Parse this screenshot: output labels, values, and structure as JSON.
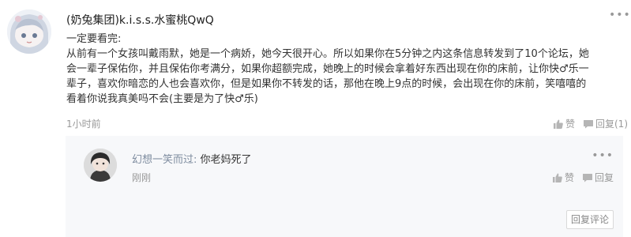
{
  "comment": {
    "username": "(奶兔集团)k.i.s.s.水蜜桃QwQ",
    "more_icon": "more-dots-icon",
    "lines": [
      "一定要看完:",
      "从前有一个女孩叫戴雨默，她是一个病娇，她今天很开心。所以如果你在5分钟之内这条信息转发到了10个论坛，她",
      "会一辈子保佑你，并且保佑你考满分，如果你超额完成，她晚上的时候会拿着好东西出现在你的床前，让你快♂乐一",
      "辈子，喜欢你暗恋的人也会喜欢你，但是如果你不转发的话，那他在晚上9点的时候，会出现在你的床前，笑嘻嘻的",
      "看着你说我真美吗不会(主要是为了快♂乐)"
    ],
    "time": "1小时前",
    "like_label": "赞",
    "reply_label": "回复(1)",
    "icons": {
      "like": "thumb-up-icon",
      "reply": "comment-icon"
    }
  },
  "reply": {
    "username": "幻想一笑而过",
    "separator": ":",
    "text": "你老妈死了",
    "time": "刚刚",
    "like_label": "赞",
    "reply_label": "回复",
    "reply_comment_button": "回复评论",
    "icons": {
      "like": "thumb-up-icon",
      "reply": "comment-icon",
      "more": "more-dots-icon"
    }
  }
}
